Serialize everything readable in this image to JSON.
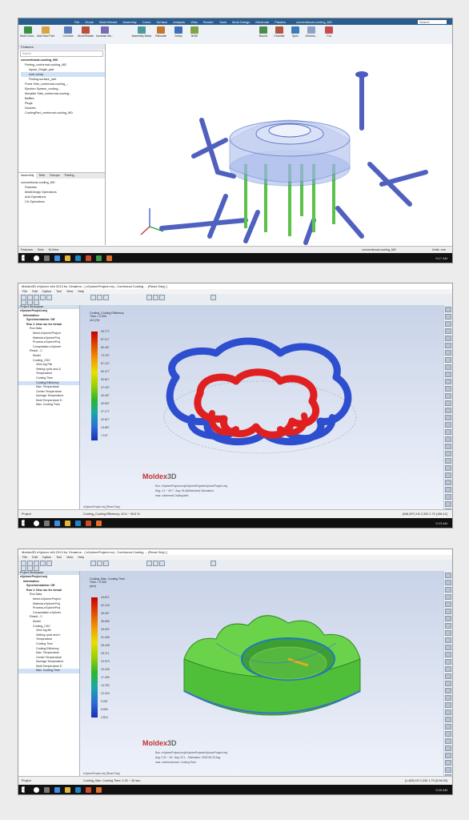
{
  "shot1": {
    "window_title": "conventional-cooling_MD",
    "menu": [
      "File",
      "Home",
      "Mold Wizard",
      "Assembly",
      "Curve",
      "Surface",
      "Analysis",
      "View",
      "Render",
      "Tools",
      "Mold Design",
      "Electrode",
      "Plastics",
      "Manufacturing"
    ],
    "search_placeholder": "Search",
    "ribbon": [
      "Mold Conn...",
      "Add New Part",
      "Connect",
      "Move/Rotate",
      "Increase Mo...",
      "Assembly Motor",
      "Relocate",
      "Setup",
      "BOM",
      "Bound",
      "Chamfer",
      "Spec",
      "Dimens...",
      "Cut"
    ],
    "navigator_title": "Features",
    "filter_placeholder": "Search",
    "tree": [
      "conventional-cooling_MD",
      "Parting_conformal-cooling_MD",
      "layout_Single_part",
      "core-comp",
      "Parting-surface_part",
      "Fixed Side_conformal-cooling_...",
      "Ejection System_cooling...",
      "Movable Side_conformal-cooling...",
      "Baffles",
      "Plugs",
      "Nozzles",
      "CoolingPart_conformal-cooling_MD"
    ],
    "tabs": [
      "Assembly",
      "Sets",
      "Groups",
      "Parting"
    ],
    "tree2": [
      "conventional-cooling_MD",
      "Features",
      "MoldDesign Operations",
      "Add Operations",
      "Ctr Operations"
    ],
    "bottom_tabs": [
      "Features",
      "Sets",
      "M-View"
    ],
    "status": "conventional-cooling_MD",
    "status_right": "Units: mm",
    "clock": "9:17 AM"
  },
  "shot2": {
    "window_title": "Moldex3D eXplorer x64 2013 for Cimatron - [ eXplorerProject.mvj - Conformal Cooling ... (Read Only) ]",
    "menu": [
      "File",
      "Edit",
      "Option",
      "Tool",
      "View",
      "Help"
    ],
    "tree_header": "Project Workspace",
    "tree": [
      "eXplorerProject.mvj",
      "Information",
      "Synchronization: Off",
      "Run 1: New run for virtual",
      "Run Data",
      "Mesh-eXplorerProject",
      "Material-eXplorerProj",
      "Process-eXplorerProj",
      "Computation-eXplorer",
      "Result - C",
      "Model",
      "Cooling_CDC",
      "View log File",
      "Setting cycle and &",
      "Temperature",
      "Cooling Time",
      "Cooling Efficiency",
      "Max. Temperature",
      "Center Temperature",
      "Average Temperature",
      "Mold Temperature D",
      "Max. Cooling Time"
    ],
    "project_tab": "Project",
    "result_title": "Cooling_Cooling Efficiency",
    "result_subtitle": "Time = 0.000",
    "unit": "(%)",
    "unit_prefix": "x10",
    "legend_values": [
      "93.777",
      "87.117",
      "80.457",
      "73.797",
      "67.137",
      "60.477",
      "53.817",
      "47.157",
      "40.497",
      "33.837",
      "27.177",
      "20.517",
      "13.857",
      "7.197"
    ],
    "logo_red": "Moldex",
    "logo_grey": "3D",
    "info_lines": [
      "Run: eXplorerProject.mvj/eXplorerProject/eXplorerProject.mvj",
      "Mvg: 4.1 ~ 93.7 : Avg: 91.6(Minimized) Sdeviation:",
      ".d20 / Valu ...",
      "max: conformal Cooling tiles"
    ],
    "status": "eXplorerProject.mvj (Read Only)",
    "status_bottom": "Cooling_Cooling Efficiency: 42.6 ~ 93.8 %",
    "status_right": "(548,397)  H2  2,330  1.70  (156.12)",
    "clock": "9:23 AM"
  },
  "shot3": {
    "window_title": "Moldex3D eXplorer x64 2013 for Cimatron - [ eXplorerProject.mvj - Conformal-Cooling ... (Read Only) ]",
    "menu": [
      "File",
      "Edit",
      "Option",
      "Tool",
      "View",
      "Help"
    ],
    "tree_header": "Project Workspace",
    "tree": [
      "eXplorerProject.mvj",
      "Information",
      "Synchronization: Off",
      "Run 1: New run for virtual",
      "Run Data",
      "Mesh-eXplorerProject",
      "Material-eXplorerProj",
      "Process-eXplorerProj",
      "Computation-eXplorer",
      "Result - C",
      "Model",
      "Cooling_CDC",
      "View log file",
      "Setting cycle and h",
      "Temperature",
      "Cooling Time",
      "Cooling Efficiency",
      "Max. Temperature",
      "Center Temperature",
      "Average Temperature",
      "Mold Temperature D",
      "Max. Cooling Time"
    ],
    "project_tab": "Project",
    "result_title": "Cooling_Max. Cooling Time",
    "result_subtitle": "Time = 0.000",
    "unit": "(sec)",
    "legend_values": [
      "44.871",
      "42.134",
      "39.397",
      "36.659",
      "33.922",
      "31.185",
      "28.448",
      "25.711",
      "22.973",
      "20.236",
      "17.499",
      "14.762",
      "12.024",
      "9.287",
      "6.550",
      "3.813"
    ],
    "logo_red": "Moldex",
    "logo_grey": "3D",
    "info_lines": [
      "Run: eXplorerProject.mvj/eXplorerProject/eXplorerProject.mvj",
      "Avg: 2.31 ~ 45 : Avg: 22.1 - Sdeviation: 2015-05-23 Avg",
      "max: conformal max: Cooling Time"
    ],
    "status": "eXplorerProject.mvj (Read Only)",
    "status_bottom": "Cooling_Max. Cooling Time: 2.31 ~ 45 sec",
    "status_right": "(1,465)  H2  2,330  1.79  (0:06:33)",
    "clock": "9:25 AM"
  }
}
